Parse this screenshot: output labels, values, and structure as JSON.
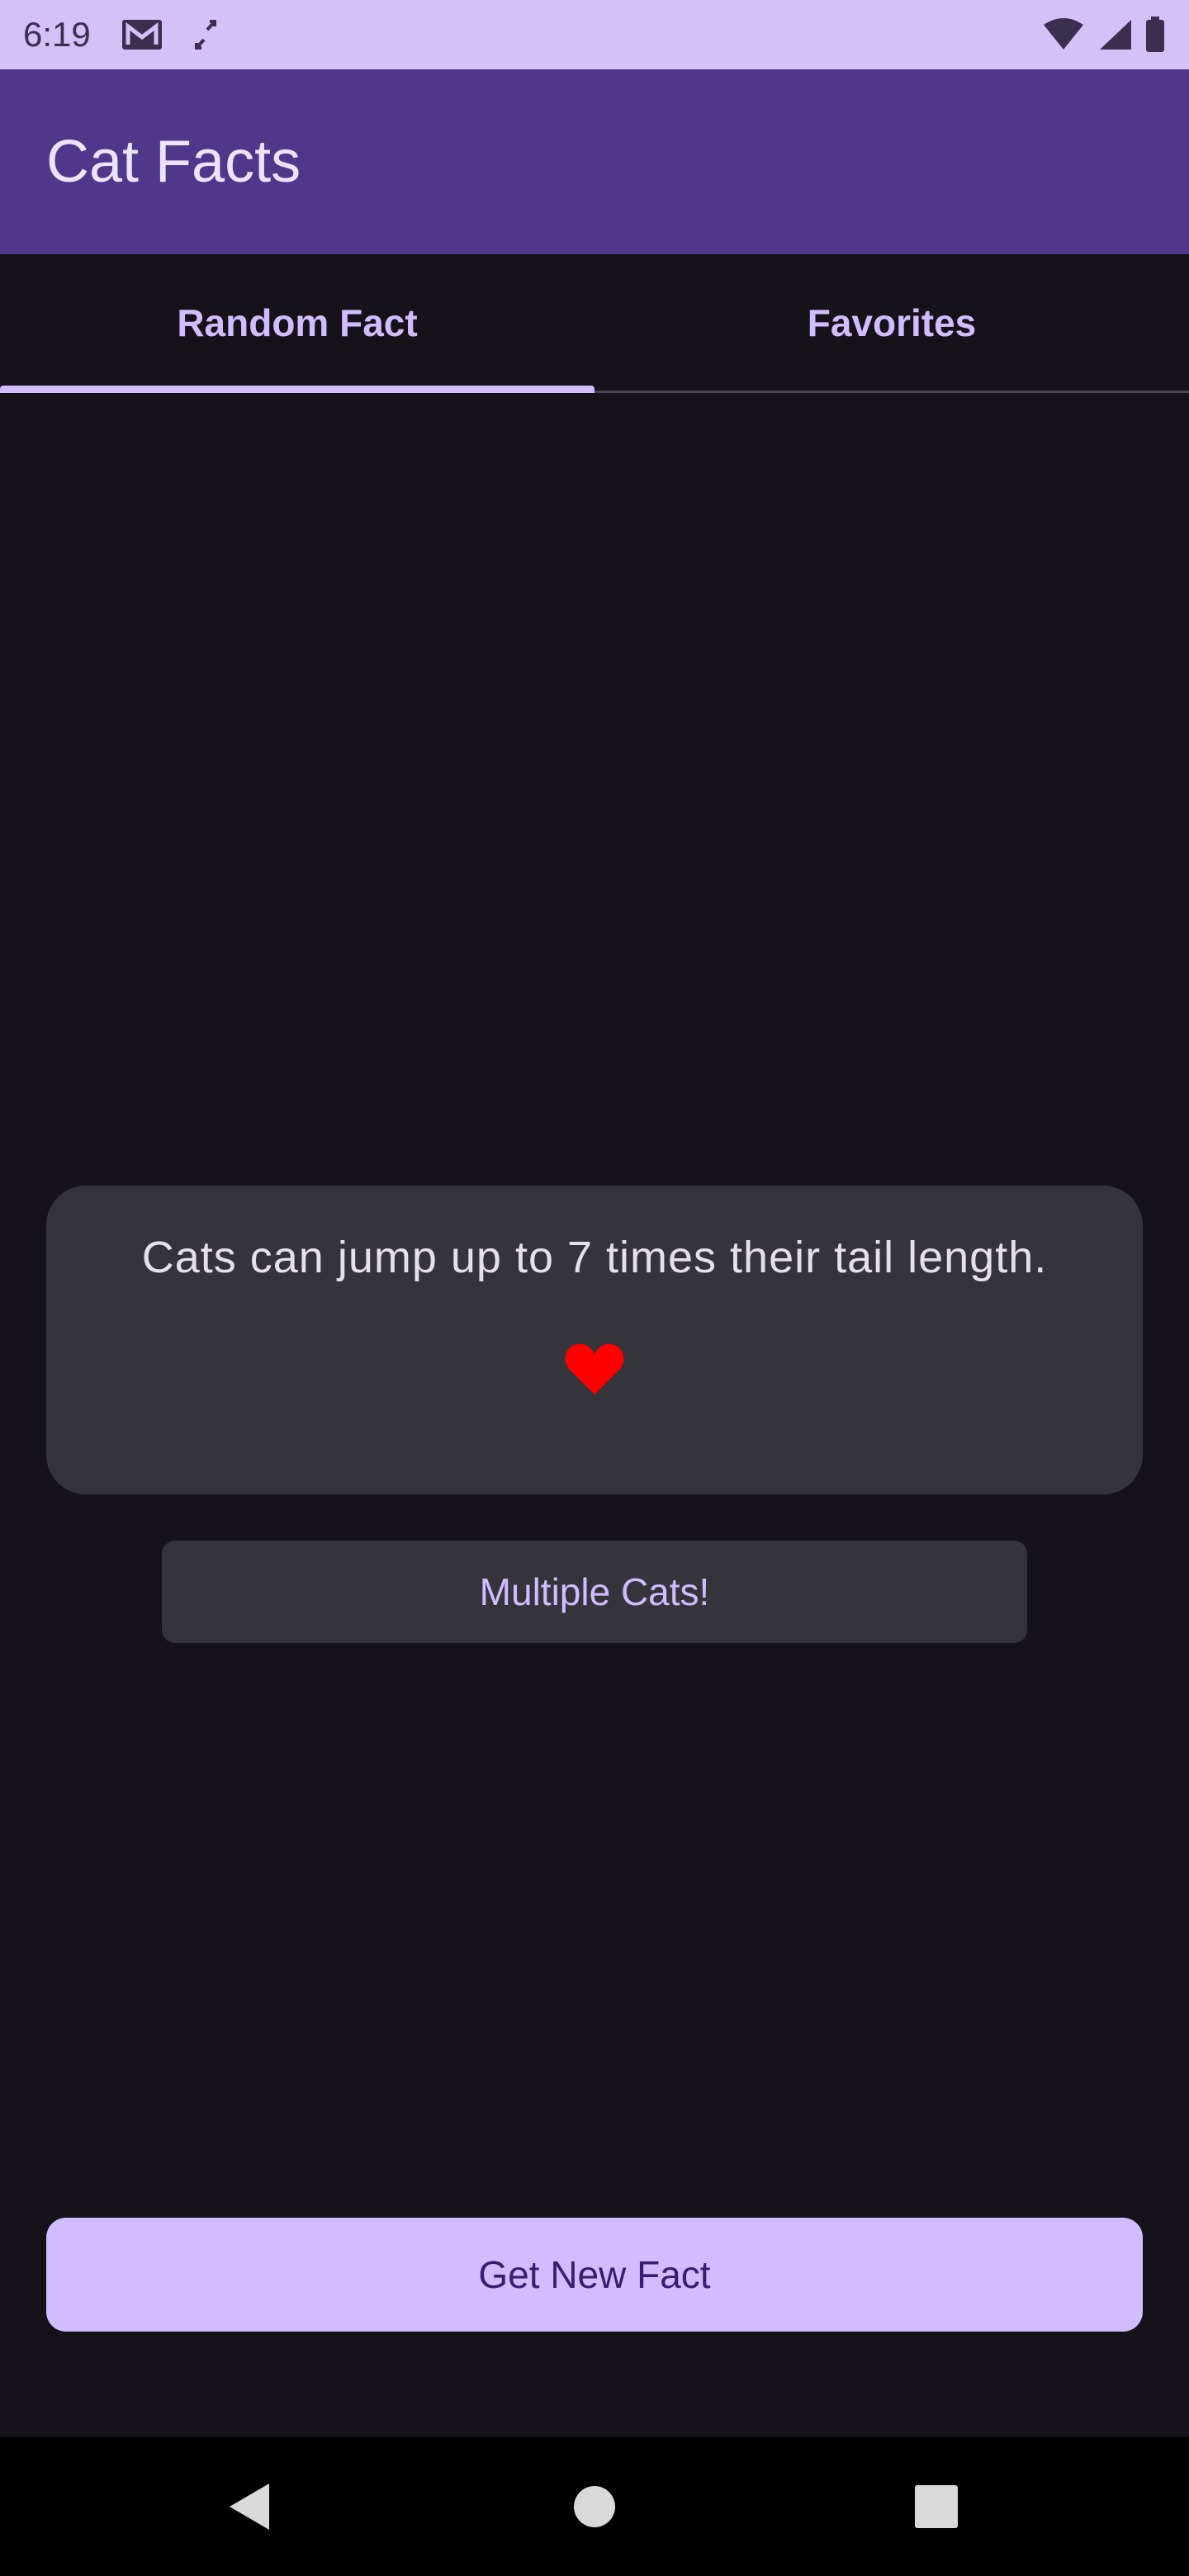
{
  "status_bar": {
    "time": "6:19",
    "left_icons": [
      "gmail-icon",
      "screen-rotate-icon"
    ],
    "right_icons": [
      "wifi-icon",
      "cellular-signal-icon",
      "battery-icon"
    ]
  },
  "app_bar": {
    "title": "Cat Facts"
  },
  "tabs": [
    {
      "label": "Random Fact",
      "selected": true
    },
    {
      "label": "Favorites",
      "selected": false
    }
  ],
  "fact_card": {
    "text": "Cats can jump up to 7 times their tail length.",
    "favorite_icon": "heart-icon",
    "favorited": true
  },
  "multiple_cats_button": {
    "label": "Multiple Cats!"
  },
  "get_new_fact_button": {
    "label": "Get New Fact"
  },
  "navigation": [
    "back-icon",
    "home-icon",
    "recents-icon"
  ],
  "colors": {
    "primary": "#d0bcff",
    "app_bar": "#4f378a",
    "status_bar": "#d2c2f8",
    "background": "#151319",
    "card": "#36343b",
    "heart": "#ff0000"
  }
}
